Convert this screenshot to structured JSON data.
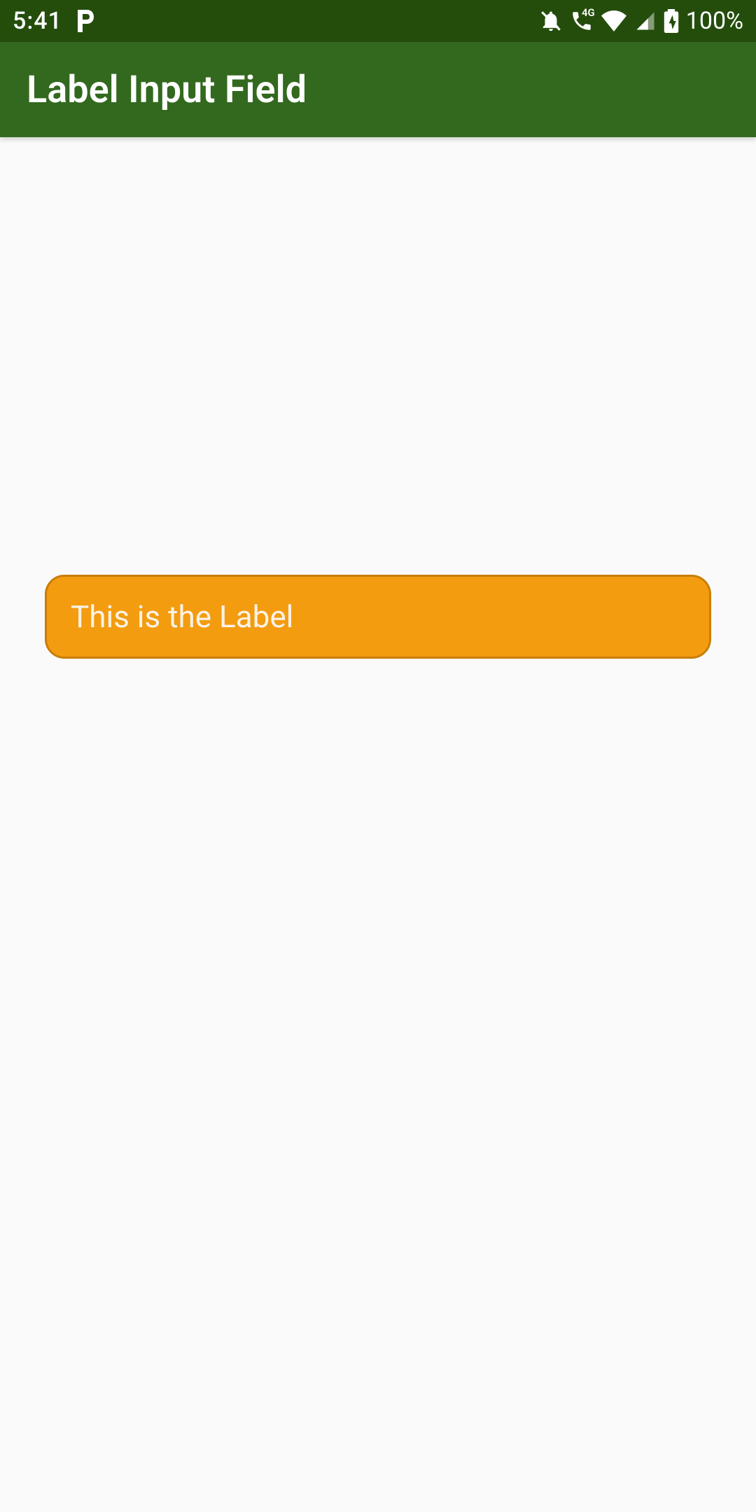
{
  "status_bar": {
    "time": "5:41",
    "battery_pct": "100%",
    "icons": {
      "app_indicator": "P",
      "alarm_off": "alarm-off",
      "call_4g": "4G",
      "wifi": "wifi",
      "signal": "signal",
      "battery": "battery-charging"
    }
  },
  "app_bar": {
    "title": "Label Input Field"
  },
  "main": {
    "input": {
      "placeholder": "This is the Label",
      "value": ""
    }
  },
  "colors": {
    "status_bar_bg": "#244d0c",
    "app_bar_bg": "#33691e",
    "field_bg": "#f39c10",
    "field_border": "#c97e08",
    "content_bg": "#fafafa"
  }
}
